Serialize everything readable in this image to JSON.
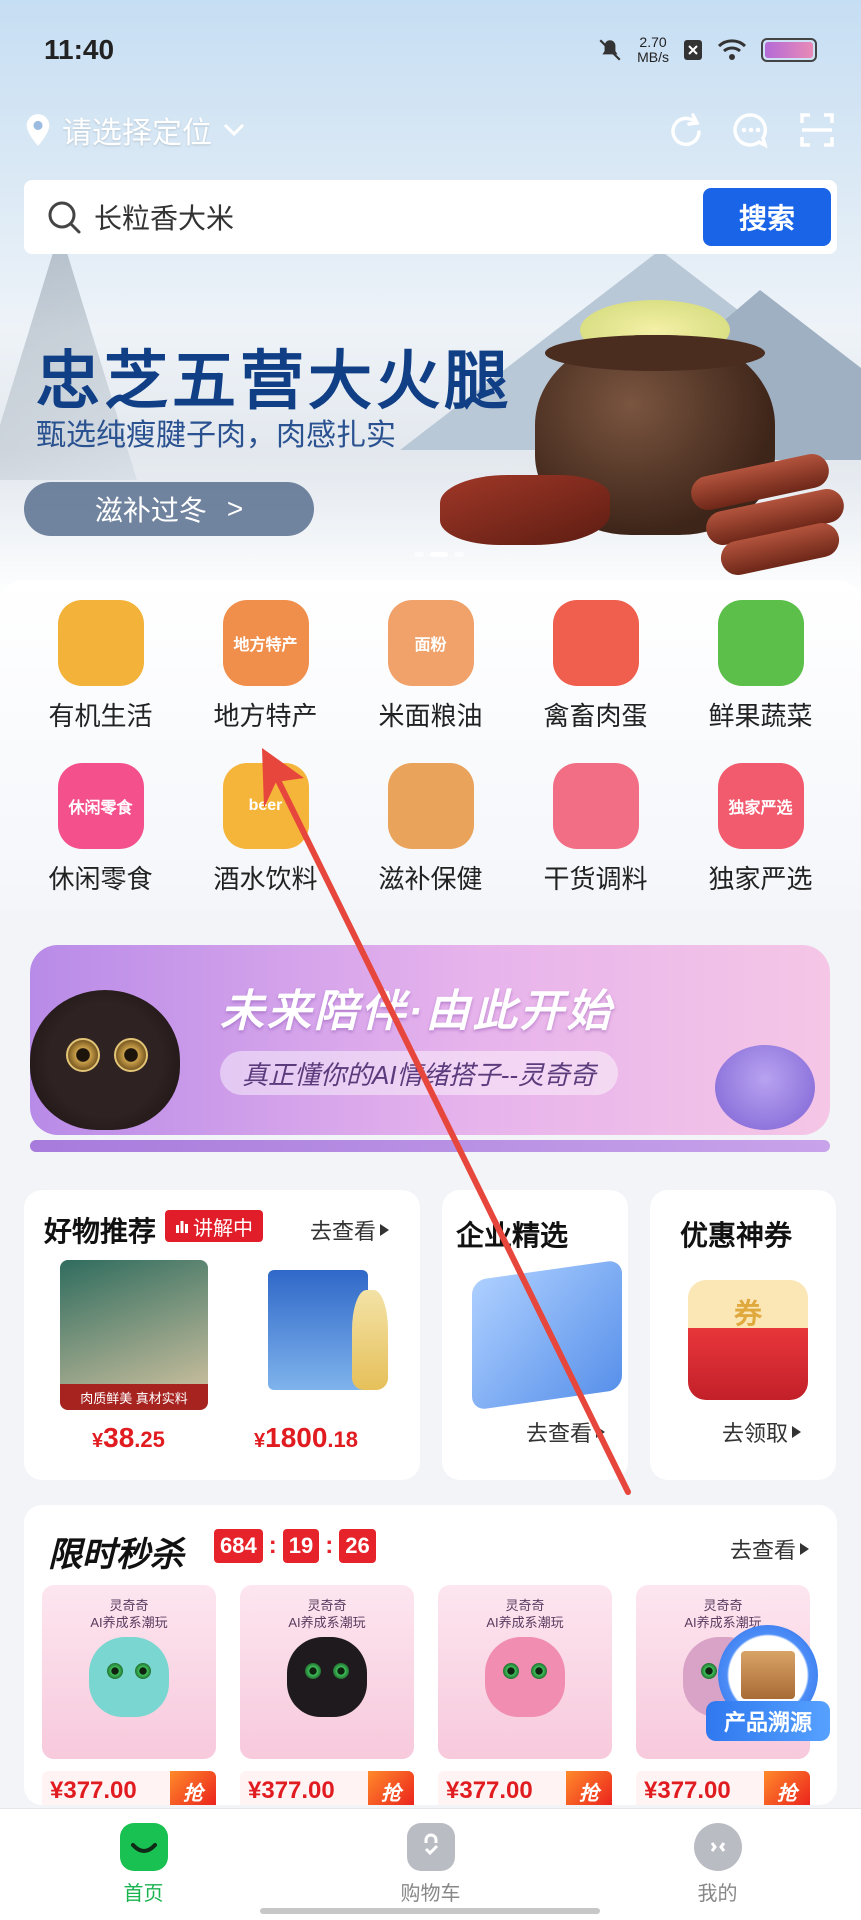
{
  "status_bar": {
    "time": "11:40",
    "net_speed_value": "2.70",
    "net_speed_unit": "MB/s"
  },
  "location": {
    "placeholder": "请选择定位"
  },
  "search": {
    "value": "长粒香大米",
    "button_label": "搜索"
  },
  "hero_banner": {
    "title": "忠芝五营大火腿",
    "subtitle": "甄选纯瘦腱子肉，肉感扎实",
    "button_label": "滋补过冬",
    "button_arrow": ">"
  },
  "categories": [
    {
      "label": "有机生活",
      "icon": "wheat-icon",
      "color": "#f3b23a"
    },
    {
      "label": "地方特产",
      "icon": "specialty-bowl-icon",
      "color": "#f08f4c"
    },
    {
      "label": "米面粮油",
      "icon": "flour-bag-icon",
      "color": "#f0a26a"
    },
    {
      "label": "禽畜肉蛋",
      "icon": "meat-icon",
      "color": "#f05e4e"
    },
    {
      "label": "鲜果蔬菜",
      "icon": "vegetable-icon",
      "color": "#5bbf4a"
    },
    {
      "label": "休闲零食",
      "icon": "snack-icon",
      "color": "#f4508c"
    },
    {
      "label": "酒水饮料",
      "icon": "beer-icon",
      "color": "#f5b53a"
    },
    {
      "label": "滋补保健",
      "icon": "ginseng-icon",
      "color": "#e9a35a"
    },
    {
      "label": "干货调料",
      "icon": "seasoning-icon",
      "color": "#f26e84"
    },
    {
      "label": "独家严选",
      "icon": "exclusive-badge-icon",
      "color": "#f25a6e"
    }
  ],
  "category_icon_texts": {
    "specialty": "地方特产",
    "flour": "面粉",
    "snack": "休闲零食",
    "beer": "beer",
    "exclusive": "独家严选"
  },
  "promo_banner": {
    "title": "未来陪伴·由此开始",
    "subtitle": "真正懂你的AI情绪搭子--灵奇奇"
  },
  "good_picks": {
    "title": "好物推荐",
    "badge": "讲解中",
    "goto_label": "去查看",
    "product_label": "肉质鲜美 真材实料",
    "items": [
      {
        "price_currency": "¥",
        "price_int": "38",
        "price_dec": ".25"
      },
      {
        "price_currency": "¥",
        "price_int": "1800",
        "price_dec": ".18"
      }
    ]
  },
  "enterprise": {
    "title": "企业精选",
    "goto_label": "去查看"
  },
  "coupons": {
    "title": "优惠神券",
    "coupon_text": "券",
    "goto_label": "去领取"
  },
  "flash_sale": {
    "title": "限时秒杀",
    "timer": {
      "h": "684",
      "m": "19",
      "s": "26"
    },
    "goto_label": "去查看",
    "items": [
      {
        "title_line1": "灵奇奇",
        "title_line2": "AI养成系潮玩",
        "price": "¥377.00",
        "grab": "抢",
        "pet_color": "#7ad6d0"
      },
      {
        "title_line1": "灵奇奇",
        "title_line2": "AI养成系潮玩",
        "price": "¥377.00",
        "grab": "抢",
        "pet_color": "#1f1a1d"
      },
      {
        "title_line1": "灵奇奇",
        "title_line2": "AI养成系潮玩",
        "price": "¥377.00",
        "grab": "抢",
        "pet_color": "#f08db0"
      },
      {
        "title_line1": "灵奇奇",
        "title_line2": "AI养成系潮玩",
        "price": "¥377.00",
        "grab": "抢",
        "pet_color": "#d9a3c7"
      }
    ]
  },
  "trace_button": {
    "label": "产品溯源"
  },
  "tabbar": {
    "items": [
      {
        "label": "首页",
        "active": true
      },
      {
        "label": "购物车",
        "active": false
      },
      {
        "label": "我的",
        "active": false
      }
    ]
  },
  "colors": {
    "accent_blue": "#1a64e8",
    "price_red": "#e11c21",
    "tab_active_green": "#19b34f"
  }
}
